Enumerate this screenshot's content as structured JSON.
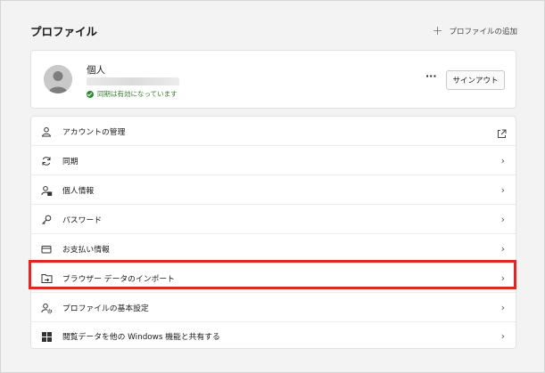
{
  "page_title": "プロファイル",
  "add_profile_label": "プロファイルの追加",
  "profile": {
    "name": "個人",
    "sync_status": "同期は有効になっています",
    "more_label": "···",
    "signout_label": "サインアウト"
  },
  "menu": [
    {
      "label": "アカウントの管理",
      "icon": "person-icon",
      "trailing": "external-link-icon"
    },
    {
      "label": "同期",
      "icon": "sync-icon",
      "trailing": "chevron"
    },
    {
      "label": "個人情報",
      "icon": "person-info-icon",
      "trailing": "chevron"
    },
    {
      "label": "パスワード",
      "icon": "key-icon",
      "trailing": "chevron"
    },
    {
      "label": "お支払い情報",
      "icon": "credit-card-icon",
      "trailing": "chevron"
    },
    {
      "label": "ブラウザー データのインポート",
      "icon": "import-icon",
      "trailing": "chevron"
    },
    {
      "label": "プロファイルの基本設定",
      "icon": "profile-settings-icon",
      "trailing": "chevron"
    },
    {
      "label": "閲覧データを他の Windows 機能と共有する",
      "icon": "windows-icon",
      "trailing": "chevron"
    }
  ],
  "chevron_glyph": "›",
  "colors": {
    "highlight": "#e02626",
    "sync_green": "#2e8b2e",
    "background": "#f3f3f3"
  }
}
